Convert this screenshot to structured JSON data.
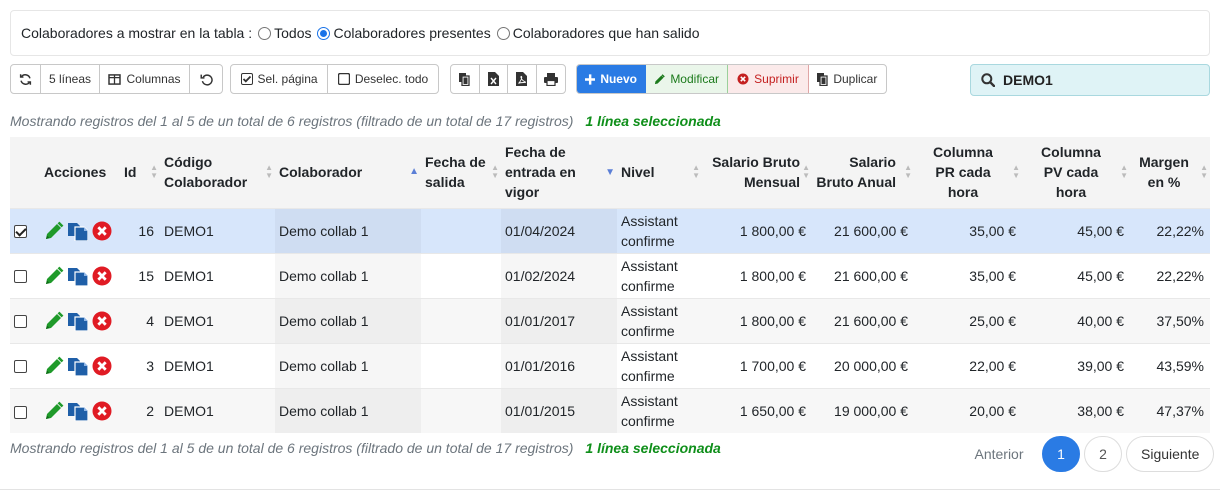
{
  "filter": {
    "label": "Colaboradores a mostrar en la tabla :",
    "options": [
      "Todos",
      "Colaboradores presentes",
      "Colaboradores que han salido"
    ],
    "selected": "Colaboradores presentes"
  },
  "toolbar": {
    "lines_label": "5 líneas",
    "columns_label": "Columnas",
    "select_page_label": "Sel. página",
    "deselect_all_label": "Deselec. todo",
    "new_label": "Nuevo",
    "edit_label": "Modificar",
    "delete_label": "Suprimir",
    "duplicate_label": "Duplicar"
  },
  "search": {
    "value": "DEMO1"
  },
  "info": {
    "text": "Mostrando registros del 1 al 5 de un total de 6 registros (filtrado de un total de 17 registros)",
    "selected": "1 línea seleccionada"
  },
  "table": {
    "headers": {
      "actions": "Acciones",
      "id": "Id",
      "code": "Código Colaborador",
      "collaborator": "Colaborador",
      "exit_date": "Fecha de salida",
      "start_date": "Fecha de entrada en vigor",
      "level": "Nivel",
      "salary_month": "Salario Bruto Mensual",
      "salary_year": "Salario Bruto Anual",
      "pr": "Columna PR cada hora",
      "pv": "Columna PV cada hora",
      "margin": "Margen en %"
    },
    "rows": [
      {
        "id": "16",
        "code": "DEMO1",
        "name": "Demo collab 1",
        "exit": "",
        "start": "01/04/2024",
        "level": "Assistant confirme",
        "sm": "1 800,00 €",
        "sy": "21 600,00 €",
        "pr": "35,00 €",
        "pv": "45,00 €",
        "margin": "22,22%"
      },
      {
        "id": "15",
        "code": "DEMO1",
        "name": "Demo collab 1",
        "exit": "",
        "start": "01/02/2024",
        "level": "Assistant confirme",
        "sm": "1 800,00 €",
        "sy": "21 600,00 €",
        "pr": "35,00 €",
        "pv": "45,00 €",
        "margin": "22,22%"
      },
      {
        "id": "4",
        "code": "DEMO1",
        "name": "Demo collab 1",
        "exit": "",
        "start": "01/01/2017",
        "level": "Assistant confirme",
        "sm": "1 800,00 €",
        "sy": "21 600,00 €",
        "pr": "25,00 €",
        "pv": "40,00 €",
        "margin": "37,50%"
      },
      {
        "id": "3",
        "code": "DEMO1",
        "name": "Demo collab 1",
        "exit": "",
        "start": "01/01/2016",
        "level": "Assistant confirme",
        "sm": "1 700,00 €",
        "sy": "20 000,00 €",
        "pr": "22,00 €",
        "pv": "39,00 €",
        "margin": "43,59%"
      },
      {
        "id": "2",
        "code": "DEMO1",
        "name": "Demo collab 1",
        "exit": "",
        "start": "01/01/2015",
        "level": "Assistant confirme",
        "sm": "1 650,00 €",
        "sy": "19 000,00 €",
        "pr": "20,00 €",
        "pv": "38,00 €",
        "margin": "47,37%"
      }
    ],
    "selected_row": 0
  },
  "pagination": {
    "prev_label": "Anterior",
    "pages": [
      "1",
      "2"
    ],
    "current": "1",
    "next_label": "Siguiente"
  },
  "colors": {
    "primary": "#2a7be4",
    "success": "#1b7a1b",
    "danger": "#c42020",
    "selected_row": "#d7e6fb",
    "search_bg": "#dff3f6"
  }
}
